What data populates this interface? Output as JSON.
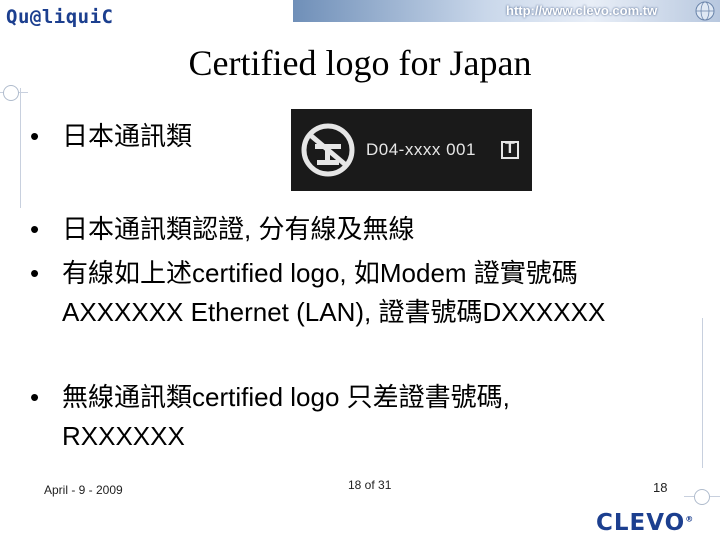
{
  "header": {
    "brand": "Qu@liquiC",
    "url": "http://www.clevo.com.tw"
  },
  "slide": {
    "title": "Certified logo for Japan",
    "bullets": [
      "日本通訊類",
      "日本通訊類認證, 分有線及無線",
      "有線如上述certified logo, 如Modem 證實號碼AXXXXXX Ethernet (LAN), 證書號碼DXXXXXX",
      "無線通訊類certified logo 只差證書號碼, RXXXXXX"
    ],
    "bullet_marker": "•",
    "logo_code": "D04-xxxx 001",
    "logo_mark": "T"
  },
  "footer": {
    "date": "April - 9 - 2009",
    "page": "18 of 31",
    "number": "18",
    "company": "CLEVO",
    "registered": "®"
  }
}
